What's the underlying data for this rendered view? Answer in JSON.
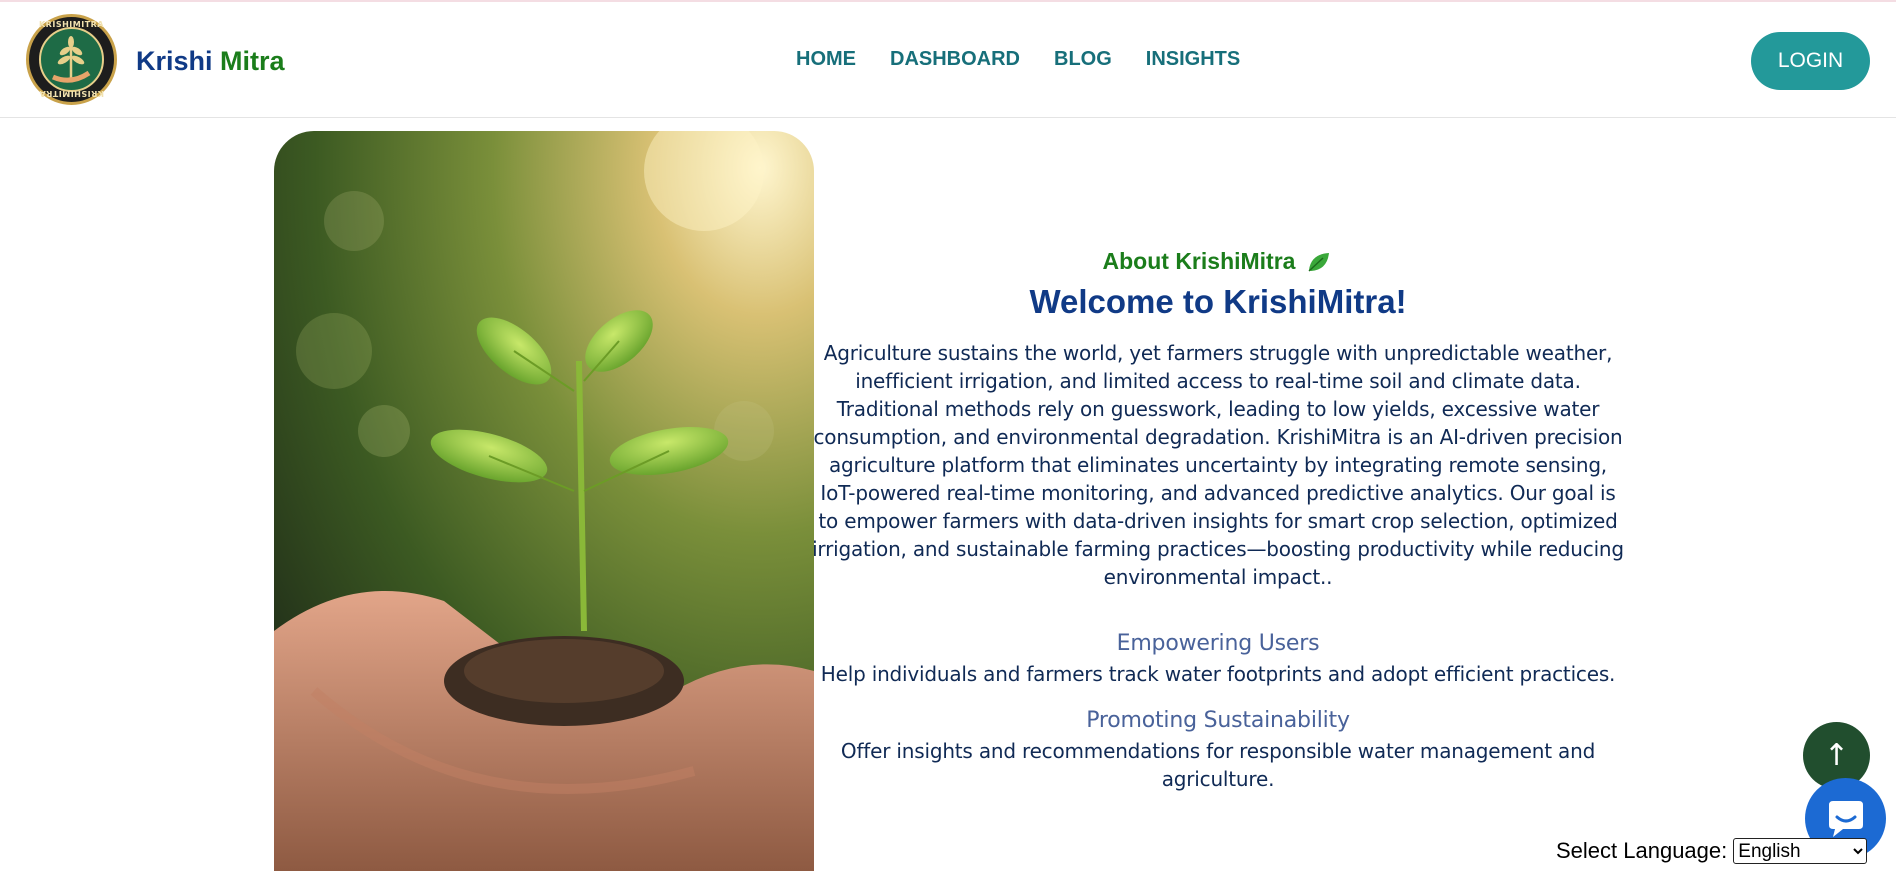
{
  "header": {
    "logo_ring_text": "KRISHIMITRA",
    "brand_part1": "Krishi",
    "brand_part2": "Mitra",
    "nav": [
      "HOME",
      "DASHBOARD",
      "BLOG",
      "INSIGHTS"
    ],
    "login_label": "LOGIN"
  },
  "main": {
    "eyebrow": "About KrishiMitra",
    "eyebrow_icon": "leaf-icon",
    "title": "Welcome to KrishiMitra!",
    "description": "Agriculture sustains the world, yet farmers struggle with unpredictable weather, inefficient irrigation, and limited access to real-time soil and climate data. Traditional methods rely on guesswork, leading to low yields, excessive water consumption, and environmental degradation. KrishiMitra is an AI-driven precision agriculture platform that eliminates uncertainty by integrating remote sensing, IoT-powered real-time monitoring, and advanced predictive analytics. Our goal is to empower farmers with data-driven insights for smart crop selection, optimized irrigation, and sustainable farming practices—boosting productivity while reducing environmental impact..",
    "features": [
      {
        "title": "Empowering Users",
        "text": "Help individuals and farmers track water footprints and adopt efficient practices."
      },
      {
        "title": "Promoting Sustainability",
        "text": "Offer insights and recommendations for responsible water management and agriculture."
      }
    ]
  },
  "floating": {
    "scroll_top_symbol": "↑",
    "chat_icon": "chat-icon",
    "language_label": "Select Language:",
    "language_selected": "English"
  },
  "colors": {
    "brand_blue": "#103a86",
    "brand_green": "#1b7d1b",
    "nav_teal": "#176f7a",
    "login_bg": "#23999a",
    "scroll_top_bg": "#214e2e",
    "chat_bg": "#1c6ad3"
  }
}
